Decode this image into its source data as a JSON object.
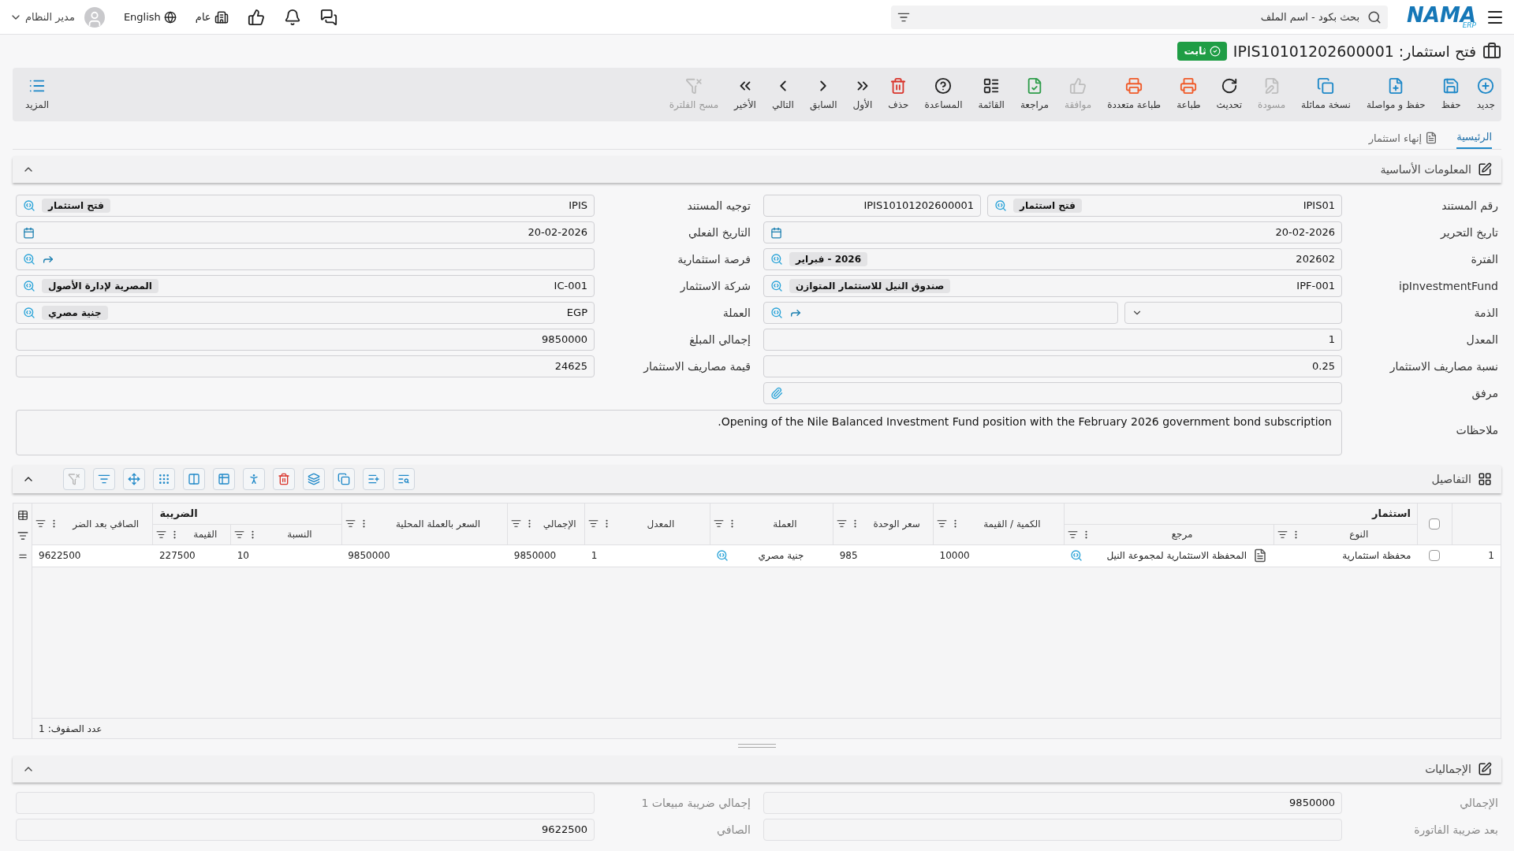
{
  "topbar": {
    "logo": "NAMA",
    "logo_sub": "ERP",
    "search": {
      "placeholder": "بحث بكود - اسم الملف"
    },
    "scope": "عام",
    "language": "English",
    "user": "مدير النظام"
  },
  "title": {
    "text": "فتح استثمار: IPIS10101202600001",
    "status": "ثابت"
  },
  "toolbar": {
    "buttons": [
      {
        "kind": "new",
        "label": "جديد",
        "disabled": false
      },
      {
        "kind": "save",
        "label": "حفظ",
        "disabled": false
      },
      {
        "kind": "save_continue",
        "label": "حفظ و مواصلة",
        "disabled": false
      },
      {
        "kind": "duplicate",
        "label": "نسخة مماثلة",
        "disabled": false
      },
      {
        "kind": "draft",
        "label": "مسودة",
        "disabled": true
      },
      {
        "kind": "refresh",
        "label": "تحديث",
        "disabled": false
      },
      {
        "kind": "print",
        "label": "طباعة",
        "disabled": false
      },
      {
        "kind": "print_multi",
        "label": "طباعة متعددة",
        "disabled": false
      },
      {
        "kind": "approve",
        "label": "موافقة",
        "disabled": true
      },
      {
        "kind": "review",
        "label": "مراجعة",
        "disabled": false
      },
      {
        "kind": "list",
        "label": "القائمة",
        "disabled": false
      },
      {
        "kind": "help",
        "label": "المساعدة",
        "disabled": false
      },
      {
        "kind": "delete",
        "label": "حذف",
        "disabled": false
      },
      {
        "kind": "first",
        "label": "الأول",
        "disabled": false
      },
      {
        "kind": "prev",
        "label": "السابق",
        "disabled": false
      },
      {
        "kind": "next",
        "label": "التالي",
        "disabled": false
      },
      {
        "kind": "last",
        "label": "الأخير",
        "disabled": false
      },
      {
        "kind": "clear_filter",
        "label": "مسح الفلترة",
        "disabled": true
      }
    ],
    "more": "المزيد"
  },
  "tabs": [
    {
      "label": "الرئيسية",
      "selected": true
    },
    {
      "label": "إنهاء استثمار",
      "selected": false
    }
  ],
  "basic_info": {
    "title": "المعلومات الأساسية",
    "expanded": true,
    "right_fields": [
      {
        "kind": "docnum",
        "label": "رقم المستند",
        "value": "IPIS01",
        "tag": "فتح استثمار",
        "extra": "IPIS10101202600001"
      },
      {
        "kind": "date",
        "label": "تاريخ التحرير",
        "value": "20-02-2026"
      },
      {
        "kind": "lookup",
        "label": "الفترة",
        "value": "202602",
        "tag": "2026 - فبراير"
      },
      {
        "kind": "lookup",
        "label": "ipInvestmentFund",
        "value": "IPF-001",
        "tag": "صندوق النيل للاستثمار المتوازن"
      },
      {
        "kind": "select_link",
        "label": "الذمة"
      },
      {
        "kind": "text",
        "label": "المعدل",
        "value": "1"
      },
      {
        "kind": "text",
        "label": "نسبة مصاريف الاستثمار",
        "value": "0.25"
      },
      {
        "kind": "attachment",
        "label": "مرفق"
      }
    ],
    "left_fields": [
      {
        "kind": "lookup",
        "label": "توجيه المستند",
        "value": "IPIS",
        "tag": "فتح استثمار"
      },
      {
        "kind": "date",
        "label": "التاريخ الفعلي",
        "value": "20-02-2026"
      },
      {
        "kind": "link",
        "label": "فرصة استثمارية"
      },
      {
        "kind": "lookup",
        "label": "شركة الاستثمار",
        "value": "IC-001",
        "tag": "المصرية لإدارة الأصول"
      },
      {
        "kind": "lookup",
        "label": "العملة",
        "value": "EGP",
        "tag": "جنية مصري"
      },
      {
        "kind": "text",
        "label": "إجمالي المبلغ",
        "value": "9850000"
      },
      {
        "kind": "text",
        "label": "قيمة مصاريف الاستثمار",
        "value": "24625"
      }
    ],
    "notes": {
      "label": "ملاحظات",
      "value": "Opening of the Nile Balanced Investment Fund position with the February 2026 government bond subscription."
    }
  },
  "details": {
    "title": "التفاصيل",
    "expanded": true,
    "tools": [
      {
        "kind": "clear_filter",
        "disabled": true
      },
      {
        "kind": "filter",
        "disabled": false
      },
      {
        "kind": "move",
        "disabled": false
      },
      {
        "kind": "grip",
        "disabled": false
      },
      {
        "kind": "columns",
        "disabled": false
      },
      {
        "kind": "group",
        "disabled": false
      },
      {
        "kind": "run",
        "disabled": false
      },
      {
        "kind": "delete",
        "disabled": false
      },
      {
        "kind": "layers",
        "disabled": false
      },
      {
        "kind": "copy",
        "disabled": false
      },
      {
        "kind": "add_list",
        "disabled": false
      },
      {
        "kind": "search",
        "disabled": false
      }
    ],
    "table": {
      "all_checked": false,
      "groups": [
        "استثمار",
        "الضريبة"
      ],
      "columns": [
        "النوع",
        "مرجع",
        "الكمية / القيمة",
        "سعر الوحدة",
        "العملة",
        "المعدل",
        "الإجمالي",
        "السعر بالعملة المحلية",
        "النسبة",
        "القيمة",
        "الصافي بعد الضر"
      ],
      "rows": [
        {
          "number": "1",
          "checked": false,
          "cells": [
            "محفظة استثمارية",
            "المحفظة الاستثمارية لمجموعة النيل",
            "10000",
            "985",
            "جنية مصري",
            "1",
            "9850000",
            "9850000",
            "10",
            "227500",
            "9622500"
          ]
        }
      ]
    },
    "row_count": {
      "label": "عدد الصفوف:",
      "value": "1"
    }
  },
  "totals": {
    "title": "الإجماليات",
    "expanded": true,
    "fields": [
      {
        "label": "الإجمالي",
        "value": "9850000"
      },
      {
        "label": "إجمالي ضريبة مبيعات 1"
      },
      {
        "label": "بعد ضريبة الفاتورة"
      },
      {
        "label": "الصافي",
        "value": "9622500"
      }
    ]
  }
}
